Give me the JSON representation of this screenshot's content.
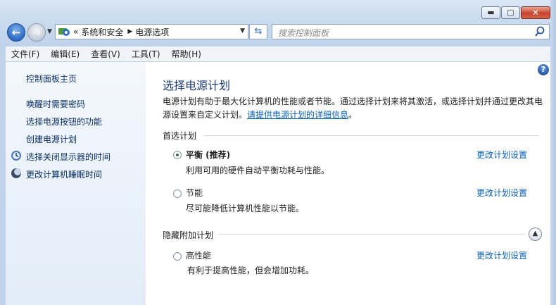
{
  "window": {
    "controls": {
      "minimize": "▬",
      "maximize": "▢",
      "close": "✕"
    }
  },
  "nav": {
    "back_icon": "arrow-left-icon",
    "forward_icon": "arrow-right-icon",
    "history_dropdown_icon": "chevron-down-icon"
  },
  "address": {
    "overflow": "«",
    "breadcrumbs": [
      "系统和安全",
      "电源选项"
    ],
    "separator_icon": "chevron-right-icon"
  },
  "search": {
    "placeholder": "搜索控制面板",
    "icon": "search-icon"
  },
  "menu": [
    "文件(F)",
    "编辑(E)",
    "查看(V)",
    "工具(T)",
    "帮助(H)"
  ],
  "sidebar": {
    "home": "控制面板主页",
    "links": [
      {
        "label": "唤醒时需要密码"
      },
      {
        "label": "选择电源按钮的功能"
      },
      {
        "label": "创建电源计划"
      },
      {
        "label": "选择关闭显示器的时间",
        "icon": "monitor-icon"
      },
      {
        "label": "更改计算机睡眠时间",
        "icon": "moon-icon"
      }
    ]
  },
  "main": {
    "title": "选择电源计划",
    "description_prefix": "电源计划有助于最大化计算机的性能或者节能。通过选择计划来将其激活，或选择计划并通过更改其电源设置来自定义计划。",
    "description_link": "请提供电源计划的详细信息",
    "description_suffix": "。",
    "preferred_section": "首选计划",
    "hidden_section": "隐藏附加计划",
    "plans": [
      {
        "name": "平衡 (推荐)",
        "desc": "利用可用的硬件自动平衡功耗与性能。",
        "link": "更改计划设置",
        "selected": true
      },
      {
        "name": "节能",
        "desc": "尽可能降低计算机性能以节能。",
        "link": "更改计划设置",
        "selected": false
      },
      {
        "name": "高性能",
        "desc": "有利于提高性能，但会增加功耗。",
        "link": "更改计划设置",
        "selected": false
      }
    ],
    "help": "?",
    "collapse_icon": "chevron-up-icon"
  }
}
